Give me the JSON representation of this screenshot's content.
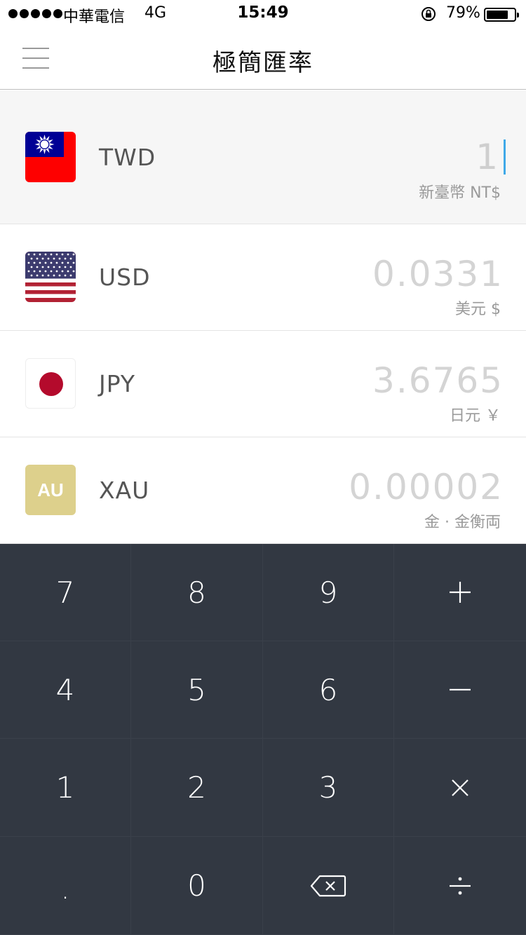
{
  "status_bar": {
    "carrier": "中華電信",
    "network": "4G",
    "time": "15:49",
    "battery_percent": "79%",
    "battery_level": 0.79,
    "signal_dots": 5
  },
  "nav": {
    "title": "極簡匯率",
    "menu_icon": "hamburger-menu-icon"
  },
  "currencies": [
    {
      "code": "TWD",
      "amount": "1",
      "name": "新臺幣 NT$",
      "flag": "taiwan-flag-icon",
      "active": true
    },
    {
      "code": "USD",
      "amount": "0.0331",
      "name": "美元 $",
      "flag": "us-flag-icon",
      "active": false
    },
    {
      "code": "JPY",
      "amount": "3.6765",
      "name": "日元 ￥",
      "flag": "japan-flag-icon",
      "active": false
    },
    {
      "code": "XAU",
      "amount": "0.00002",
      "name": "金 · 金衡両",
      "flag": "gold-au-icon",
      "flag_text": "AU",
      "active": false
    }
  ],
  "keypad": {
    "keys": [
      "7",
      "8",
      "9",
      "+",
      "4",
      "5",
      "6",
      "−",
      "1",
      "2",
      "3",
      "×",
      ".",
      "0",
      "backspace",
      "÷"
    ]
  },
  "colors": {
    "keypad_bg": "#323842",
    "cursor": "#3fa9e8",
    "gold": "#ddd08c",
    "japan_red": "#b40a2c"
  }
}
